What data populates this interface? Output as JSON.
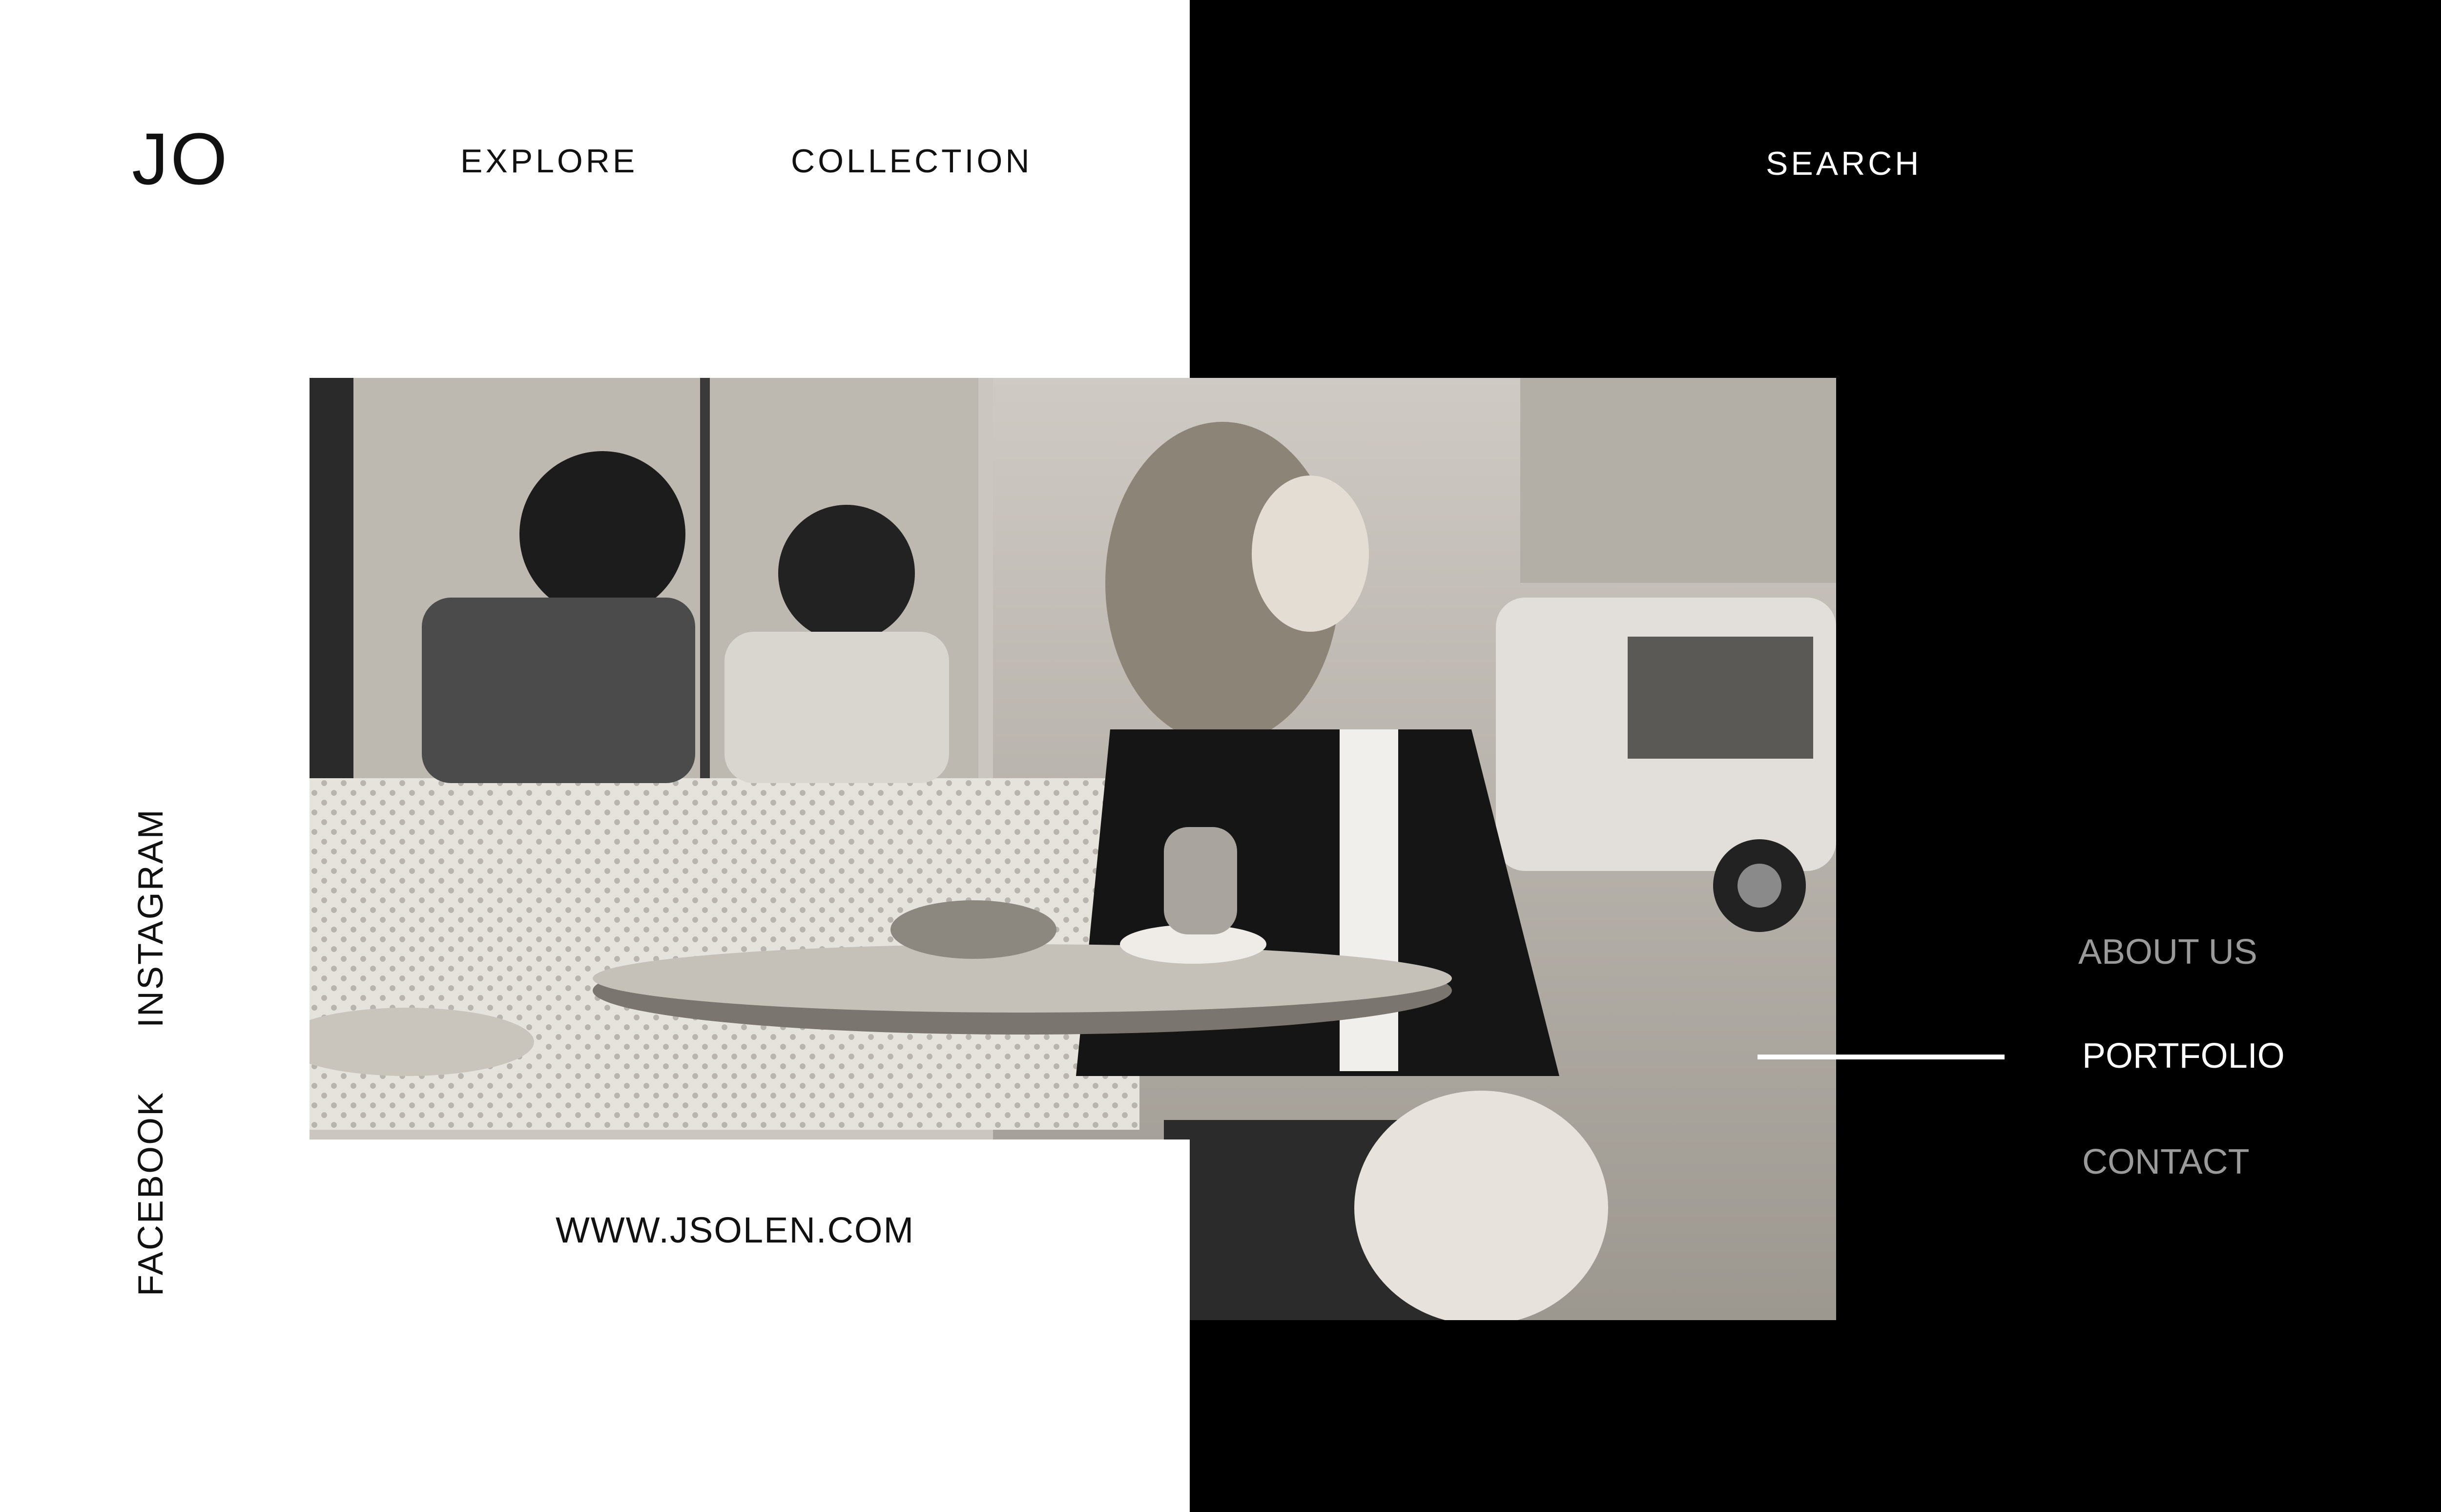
{
  "brand": {
    "logo": "JO"
  },
  "nav": {
    "explore": "EXPLORE",
    "collection": "COLLECTION",
    "search": "SEARCH"
  },
  "hero": {
    "image_icon": "cafe-photo"
  },
  "url": "WWW.JSOLEN.COM",
  "social": {
    "instagram": "INSTAGRAM",
    "facebook": "FACEBOOK"
  },
  "menu": {
    "about": "ABOUT US",
    "portfolio": "PORTFOLIO",
    "contact": "CONTACT",
    "active": "PORTFOLIO"
  },
  "colors": {
    "background_left": "#ffffff",
    "background_right": "#000000",
    "muted": "#9a9a9a"
  }
}
